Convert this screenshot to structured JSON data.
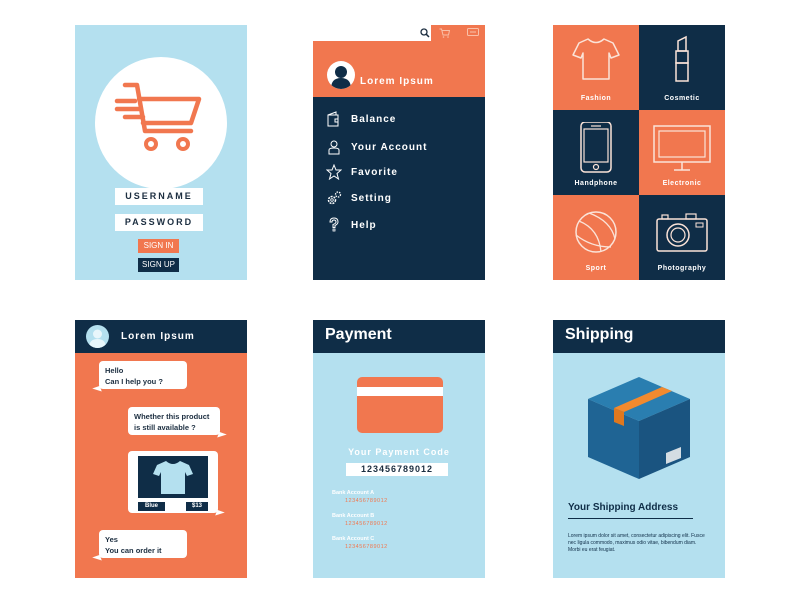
{
  "colors": {
    "navy": "#0f2d47",
    "orange": "#f1774f",
    "sky": "#b4e0ef",
    "white": "#ffffff"
  },
  "login": {
    "logo_icon": "shopping-cart-icon",
    "username_placeholder": "USERNAME",
    "password_placeholder": "PASSWORD",
    "sign_in_label": "SIGN IN",
    "sign_up_label": "SIGN UP"
  },
  "menu": {
    "top_icons": [
      "search-icon",
      "cart-icon",
      "chat-icon"
    ],
    "user_name": "Lorem Ipsum",
    "items": [
      {
        "label": "Balance",
        "icon": "wallet-icon"
      },
      {
        "label": "Your Account",
        "icon": "user-icon"
      },
      {
        "label": "Favorite",
        "icon": "star-icon"
      },
      {
        "label": "Setting",
        "icon": "gear-icon"
      },
      {
        "label": "Help",
        "icon": "question-icon"
      }
    ]
  },
  "categories": {
    "items": [
      {
        "label": "Fashion",
        "icon": "tshirt-icon"
      },
      {
        "label": "Cosmetic",
        "icon": "lipstick-icon"
      },
      {
        "label": "Handphone",
        "icon": "phone-icon"
      },
      {
        "label": "Electronic",
        "icon": "monitor-icon"
      },
      {
        "label": "Sport",
        "icon": "basketball-icon"
      },
      {
        "label": "Photography",
        "icon": "camera-icon"
      }
    ]
  },
  "chat": {
    "title": "Lorem Ipsum",
    "messages": [
      {
        "side": "left",
        "line1": "Hello",
        "line2": "Can I help you ?"
      },
      {
        "side": "right",
        "line1": "Whether this product",
        "line2": "is still available ?"
      },
      {
        "side": "right",
        "type": "product",
        "color": "Blue",
        "price": "$13"
      },
      {
        "side": "left",
        "line1": "Yes",
        "line2": "You can order it"
      }
    ]
  },
  "payment": {
    "title": "Payment",
    "code_label": "Your Payment Code",
    "code_value": "123456789012",
    "accounts": [
      {
        "name": "Bank Account A",
        "number": "123456789012"
      },
      {
        "name": "Bank Account B",
        "number": "123456789012"
      },
      {
        "name": "Bank Account C",
        "number": "123456789012"
      }
    ]
  },
  "shipping": {
    "title": "Shipping",
    "address_title": "Your Shipping Address",
    "address_text": "Lorem ipsum dolor sit amet, consectetur adipiscing elit. Fusce nec ligula commodo, maximus odio vitae, bibendum diam. Morbi eu erat feugiat."
  }
}
